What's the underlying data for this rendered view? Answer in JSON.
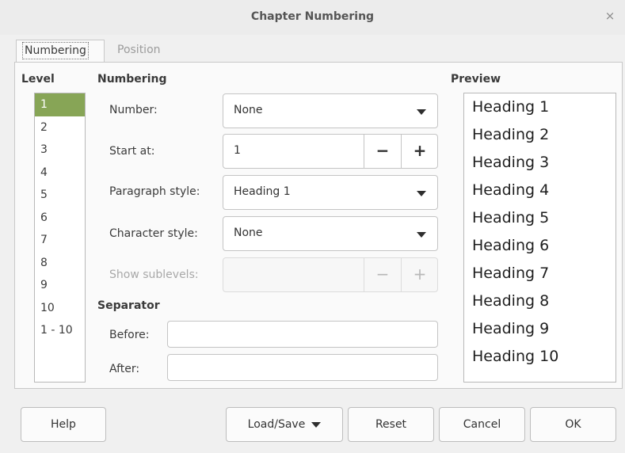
{
  "window": {
    "title": "Chapter Numbering",
    "close_glyph": "×"
  },
  "tabs": [
    {
      "label": "Numbering",
      "active": true
    },
    {
      "label": "Position",
      "active": false
    }
  ],
  "level": {
    "heading": "Level",
    "items": [
      "1",
      "2",
      "3",
      "4",
      "5",
      "6",
      "7",
      "8",
      "9",
      "10",
      "1 - 10"
    ],
    "selected": "1"
  },
  "numbering": {
    "heading": "Numbering",
    "number_label": "Number:",
    "number_value": "None",
    "start_label": "Start at:",
    "start_value": "1",
    "para_style_label": "Paragraph style:",
    "para_style_value": "Heading 1",
    "char_style_label": "Character style:",
    "char_style_value": "None",
    "sublevels_label": "Show sublevels:",
    "sublevels_value": "",
    "minus": "−",
    "plus": "+"
  },
  "separator": {
    "heading": "Separator",
    "before_label": "Before:",
    "before_value": "",
    "after_label": "After:",
    "after_value": ""
  },
  "preview": {
    "heading": "Preview",
    "items": [
      "Heading 1",
      "Heading 2",
      "Heading 3",
      "Heading 4",
      "Heading 5",
      "Heading 6",
      "Heading 7",
      "Heading 8",
      "Heading 9",
      "Heading 10"
    ]
  },
  "buttons": {
    "help": "Help",
    "load_save": "Load/Save",
    "reset": "Reset",
    "cancel": "Cancel",
    "ok": "OK"
  },
  "colors": {
    "selection": "#87a556"
  }
}
